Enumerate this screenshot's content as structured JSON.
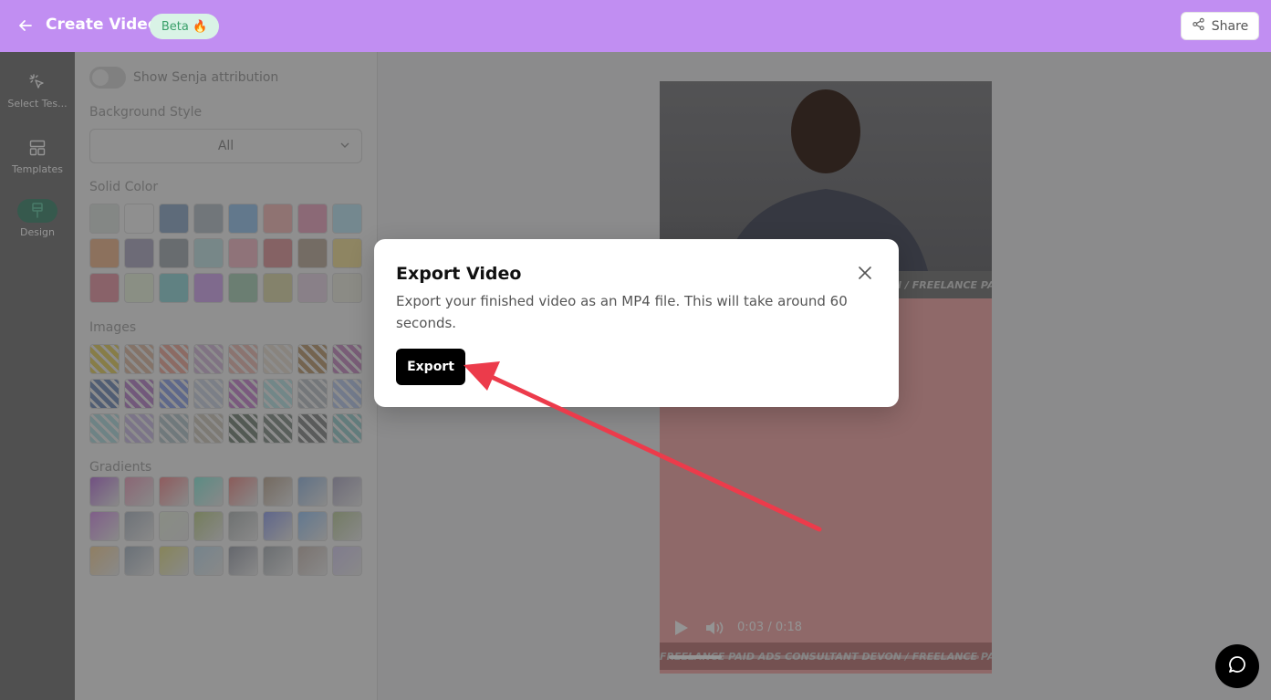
{
  "header": {
    "back_icon": "arrow-left-icon",
    "title": "Create Video",
    "badge": "Beta 🔥",
    "share_label": "Share",
    "share_icon": "share-icon"
  },
  "leftnav": {
    "items": [
      {
        "label": "Select Tes...",
        "icon": "cursor-click-icon"
      },
      {
        "label": "Templates",
        "icon": "layout-icon"
      },
      {
        "label": "Design",
        "icon": "paint-brush-icon",
        "active": true
      }
    ]
  },
  "panel": {
    "attribution_label": "Show Senja attribution",
    "attribution_on": false,
    "bg_style_label": "Background Style",
    "bg_style_value": "All",
    "solid_label": "Solid Color",
    "images_label": "Images",
    "gradients_label": "Gradients",
    "solid_colors": [
      "#e3e9e6",
      "#f6f6f6",
      "#a3b9d3",
      "#c3cbd3",
      "#a9cff2",
      "#f7c6c5",
      "#f0b5cc",
      "#c8ebf7",
      "#f2c3a0",
      "#bcb9cd",
      "#b4babf",
      "#cde9ea",
      "#f6c6d1",
      "#e5a9ad",
      "#c8bbac",
      "#f5e6a9",
      "#ecaab5",
      "#eef6e4",
      "#a6dfe0",
      "#dbb7f3",
      "#b8d9c5",
      "#e3e0b8",
      "#eddcea",
      "#f0f0e6"
    ],
    "image_colors": [
      "#e9d87d",
      "#e3c6b4",
      "#f1b9ad",
      "#dcc6e2",
      "#f0c9c2",
      "#ece3da",
      "#c9ad8b",
      "#d1a0cd",
      "#8ba1c6",
      "#c49ad5",
      "#a3b4ee",
      "#d5dbe8",
      "#d39cd9",
      "#c5e9ea",
      "#c9cdd2",
      "#c5d3ef",
      "#bde2e6",
      "#d4c9ea",
      "#c1d1d6",
      "#d8d3c8",
      "#8f9b92",
      "#9aa49d",
      "#9b9e9e",
      "#a9d6d6"
    ],
    "gradient_colors": [
      "#c48ce0",
      "#efb1c9",
      "#f59ea2",
      "#9ff0e3",
      "#ef9f9c",
      "#c8b7a6",
      "#a7c4e6",
      "#bdb9cf",
      "#dca3ec",
      "#bdc5cf",
      "#edf4e4",
      "#c9d89f",
      "#bfc4c4",
      "#a4b0ef",
      "#a9cff7",
      "#c7d5ad",
      "#f8dbab",
      "#b6c2ce",
      "#e8e59b",
      "#cbe3f1",
      "#aeb2bc",
      "#b8bec3",
      "#d3c7c1",
      "#ddd6f4"
    ]
  },
  "video": {
    "ticker_text": "FREELANCE PAID ADS CONSULTANT  DEVON  /  FREELANCE PAID ADS CONSULTANT",
    "time": "0:03 / 0:18",
    "progress": 0.17,
    "play_icon": "play-icon",
    "volume_icon": "volume-icon"
  },
  "modal": {
    "title": "Export Video",
    "description": "Export your finished video as an MP4 file. This will take around 60 seconds.",
    "export_label": "Export",
    "close_icon": "close-icon"
  },
  "chat_icon": "chat-bubble-icon",
  "colors": {
    "header": "#c18ef2",
    "annotation_arrow": "#ec3b4b"
  }
}
